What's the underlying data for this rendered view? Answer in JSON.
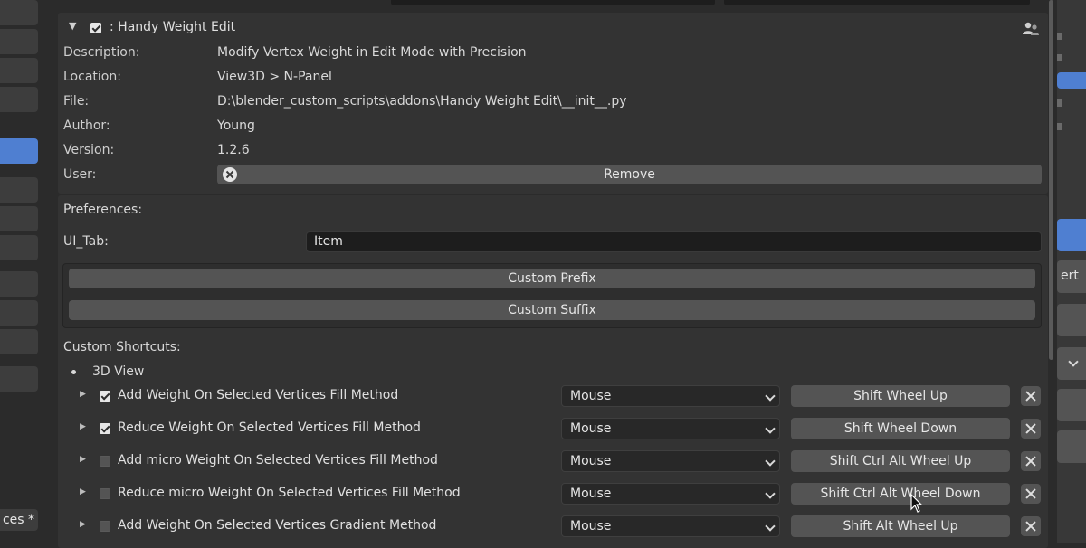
{
  "addon": {
    "title": ": Handy Weight Edit",
    "enabled": true,
    "info": [
      {
        "label": "Description:",
        "value": "Modify Vertex Weight in Edit Mode with Precision"
      },
      {
        "label": "Location:",
        "value": "View3D > N-Panel"
      },
      {
        "label": "File:",
        "value": "D:\\blender_custom_scripts\\addons\\Handy Weight Edit\\__init__.py"
      },
      {
        "label": "Author:",
        "value": "Young"
      },
      {
        "label": "Version:",
        "value": "1.2.6"
      }
    ],
    "user_label": "User:",
    "remove_label": "Remove"
  },
  "preferences": {
    "heading": "Preferences:",
    "ui_tab_label": "UI_Tab:",
    "ui_tab_value": "Item",
    "custom_prefix_label": "Custom Prefix",
    "custom_suffix_label": "Custom Suffix",
    "shortcuts_heading": "Custom Shortcuts:",
    "category": "3D View",
    "shortcuts": [
      {
        "name": "Add Weight On Selected Vertices Fill Method",
        "enabled": true,
        "input_type": "Mouse",
        "key": "Shift Wheel Up"
      },
      {
        "name": "Reduce Weight On Selected Vertices Fill Method",
        "enabled": true,
        "input_type": "Mouse",
        "key": "Shift Wheel Down"
      },
      {
        "name": "Add micro Weight On Selected Vertices Fill Method",
        "enabled": false,
        "input_type": "Mouse",
        "key": "Shift Ctrl Alt Wheel Up"
      },
      {
        "name": "Reduce micro Weight On Selected Vertices Fill Method",
        "enabled": false,
        "input_type": "Mouse",
        "key": "Shift Ctrl Alt Wheel Down"
      },
      {
        "name": "Add Weight On Selected Vertices Gradient Method",
        "enabled": false,
        "input_type": "Mouse",
        "key": "Shift Alt Wheel Up"
      }
    ]
  },
  "sidebar": {
    "partial_label": "ces *"
  },
  "right_panel": {
    "partial_label": "ert"
  },
  "colors": {
    "background": "#2b2b2b",
    "panel": "#333333",
    "button": "#545454",
    "field": "#1d1d1d",
    "accent": "#4f7fd1"
  }
}
